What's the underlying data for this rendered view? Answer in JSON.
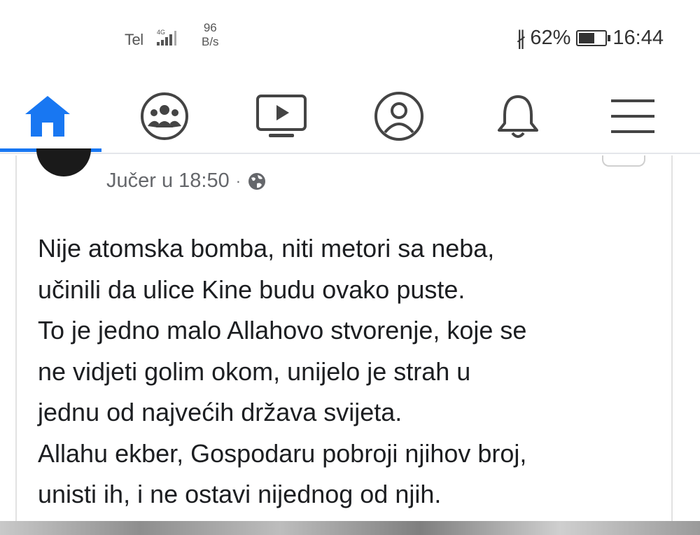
{
  "status_bar": {
    "carrier": "Tel",
    "network_type": "4G",
    "speed_value": "96",
    "speed_unit": "B/s",
    "battery_percent": "62%",
    "battery_level": 0.62,
    "time": "16:44"
  },
  "nav": {
    "items": [
      {
        "name": "home",
        "icon": "home-icon",
        "active": true
      },
      {
        "name": "groups",
        "icon": "groups-icon",
        "active": false
      },
      {
        "name": "watch",
        "icon": "video-icon",
        "active": false
      },
      {
        "name": "profile",
        "icon": "profile-icon",
        "active": false
      },
      {
        "name": "notifications",
        "icon": "bell-icon",
        "active": false
      },
      {
        "name": "menu",
        "icon": "hamburger-menu-icon",
        "active": false
      }
    ],
    "accent_color": "#1877f2"
  },
  "post": {
    "timestamp": "Jučer u 18:50",
    "separator": "·",
    "privacy_icon": "globe-icon",
    "lines": [
      "Nije atomska bomba, niti metori sa neba,",
      "učinili da ulice Kine budu ovako puste.",
      "To je jedno malo Allahovo stvorenje, koje se",
      "ne vidjeti golim okom, unijelo je strah u",
      "jednu od najvećih država svijeta.",
      "Allahu ekber, Gospodaru pobroji njihov broj,",
      "unisti ih, i ne ostavi nijednog od njih."
    ]
  }
}
